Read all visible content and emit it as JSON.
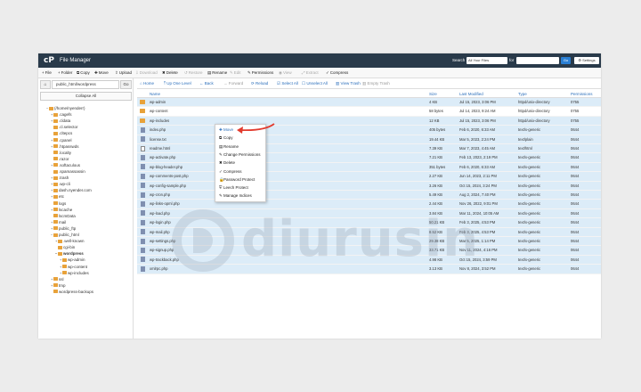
{
  "topbar": {
    "title": "File Manager",
    "search_label": "Search",
    "search_scope": "All Your Files",
    "search_for_label": "for",
    "go_label": "Go",
    "settings_label": "Settings"
  },
  "toolbar": [
    {
      "icon": "+",
      "label": "File",
      "disabled": false
    },
    {
      "icon": "+",
      "label": "Folder",
      "disabled": false
    },
    {
      "icon": "⧉",
      "label": "Copy",
      "disabled": false
    },
    {
      "icon": "✚",
      "label": "Move",
      "disabled": false
    },
    {
      "icon": "⇪",
      "label": "Upload",
      "disabled": false
    },
    {
      "icon": "⇩",
      "label": "Download",
      "disabled": true
    },
    {
      "icon": "✖",
      "label": "Delete",
      "disabled": false
    },
    {
      "icon": "↺",
      "label": "Restore",
      "disabled": true
    },
    {
      "icon": "▤",
      "label": "Rename",
      "disabled": false
    },
    {
      "icon": "✎",
      "label": "Edit",
      "disabled": true
    },
    {
      "icon": "✎",
      "label": "Permissions",
      "disabled": false
    },
    {
      "icon": "◉",
      "label": "View",
      "disabled": true
    },
    {
      "icon": "⤢",
      "label": "Extract",
      "disabled": true
    },
    {
      "icon": "✓",
      "label": "Compress",
      "disabled": false
    }
  ],
  "left": {
    "path_value": "public_html/wordpress",
    "go_label": "Go",
    "collapse_label": "Collapse All",
    "tree": [
      {
        "label": "(/home/nyenderr)",
        "depth": 0,
        "expander": "−",
        "bold": false
      },
      {
        "label": ".cagefs",
        "depth": 1,
        "expander": "+",
        "bold": false
      },
      {
        "label": ".cldata",
        "depth": 1,
        "expander": "+",
        "bold": false
      },
      {
        "label": ".cl.selector",
        "depth": 1,
        "expander": "",
        "bold": false
      },
      {
        "label": ".cltepcs",
        "depth": 1,
        "expander": "",
        "bold": false
      },
      {
        "label": ".cpanel",
        "depth": 1,
        "expander": "+",
        "bold": false
      },
      {
        "label": ".htpasswds",
        "depth": 1,
        "expander": "+",
        "bold": false
      },
      {
        "label": ".localty",
        "depth": 1,
        "expander": "",
        "bold": false
      },
      {
        "label": ".razor",
        "depth": 1,
        "expander": "",
        "bold": false
      },
      {
        "label": ".softaculous",
        "depth": 1,
        "expander": "+",
        "bold": false
      },
      {
        "label": ".spamassassin",
        "depth": 1,
        "expander": "",
        "bold": false
      },
      {
        "label": ".trash",
        "depth": 1,
        "expander": "+",
        "bold": false
      },
      {
        "label": ".wp-cli",
        "depth": 1,
        "expander": "+",
        "bold": false
      },
      {
        "label": "dash.nyender.com",
        "depth": 1,
        "expander": "+",
        "bold": false
      },
      {
        "label": "etc",
        "depth": 1,
        "expander": "+",
        "bold": false
      },
      {
        "label": "logs",
        "depth": 1,
        "expander": "",
        "bold": false
      },
      {
        "label": "lscache",
        "depth": 1,
        "expander": "+",
        "bold": false
      },
      {
        "label": "lscmData",
        "depth": 1,
        "expander": "",
        "bold": false
      },
      {
        "label": "mail",
        "depth": 1,
        "expander": "+",
        "bold": false
      },
      {
        "label": "public_ftp",
        "depth": 1,
        "expander": "+",
        "bold": false
      },
      {
        "label": "public_html",
        "depth": 1,
        "expander": "−",
        "bold": false
      },
      {
        "label": ".well-known",
        "depth": 2,
        "expander": "+",
        "bold": false
      },
      {
        "label": "cgi-bin",
        "depth": 2,
        "expander": "",
        "bold": false
      },
      {
        "label": "wordpress",
        "depth": 2,
        "expander": "−",
        "bold": true
      },
      {
        "label": "wp-admin",
        "depth": 3,
        "expander": "+",
        "bold": false
      },
      {
        "label": "wp-content",
        "depth": 3,
        "expander": "+",
        "bold": false
      },
      {
        "label": "wp-includes",
        "depth": 3,
        "expander": "+",
        "bold": false
      },
      {
        "label": "ssl",
        "depth": 1,
        "expander": "+",
        "bold": false
      },
      {
        "label": "tmp",
        "depth": 1,
        "expander": "+",
        "bold": false
      },
      {
        "label": "wordpress-backups",
        "depth": 1,
        "expander": "",
        "bold": false
      }
    ]
  },
  "actions": [
    {
      "icon": "⌂",
      "label": "Home",
      "disabled": false
    },
    {
      "icon": "⤒",
      "label": "Up One Level",
      "disabled": false
    },
    {
      "icon": "←",
      "label": "Back",
      "disabled": false
    },
    {
      "icon": "→",
      "label": "Forward",
      "disabled": true
    },
    {
      "icon": "⟳",
      "label": "Reload",
      "disabled": false
    },
    {
      "icon": "☑",
      "label": "Select All",
      "disabled": false
    },
    {
      "icon": "☐",
      "label": "Unselect All",
      "disabled": false
    },
    {
      "icon": "▥",
      "label": "View Trash",
      "disabled": false
    },
    {
      "icon": "▥",
      "label": "Empty Trash",
      "disabled": true
    }
  ],
  "columns": {
    "name": "Name",
    "size": "Size",
    "modified": "Last Modified",
    "type": "Type",
    "perms": "Permissions"
  },
  "files": [
    {
      "name": "wp-admin",
      "size": "4 KB",
      "modified": "Jul 15, 2023, 3:06 PM",
      "type": "httpd/unix-directory",
      "perms": "0755",
      "kind": "dir",
      "selected": true
    },
    {
      "name": "wp-content",
      "size": "58 bytes",
      "modified": "Jul 14, 2023, 9:24 AM",
      "type": "httpd/unix-directory",
      "perms": "0755",
      "kind": "dir",
      "selected": false
    },
    {
      "name": "wp-includes",
      "size": "12 KB",
      "modified": "Jul 15, 2023, 3:06 PM",
      "type": "httpd/unix-directory",
      "perms": "0755",
      "kind": "dir",
      "selected": true
    },
    {
      "name": "index.php",
      "size": "405 bytes",
      "modified": "Feb 6, 2020, 6:33 AM",
      "type": "text/x-generic",
      "perms": "0644",
      "kind": "file",
      "selected": true
    },
    {
      "name": "license.txt",
      "size": "19.44 KB",
      "modified": "Mar 5, 2023, 2:24 PM",
      "type": "text/plain",
      "perms": "0644",
      "kind": "file",
      "selected": true
    },
    {
      "name": "readme.html",
      "size": "7.39 KB",
      "modified": "Mar 7, 2023, 4:45 AM",
      "type": "text/html",
      "perms": "0644",
      "kind": "txt",
      "selected": true
    },
    {
      "name": "wp-activate.php",
      "size": "7.21 KB",
      "modified": "Feb 13, 2023, 2:19 PM",
      "type": "text/x-generic",
      "perms": "0644",
      "kind": "file",
      "selected": true
    },
    {
      "name": "wp-blog-header.php",
      "size": "351 bytes",
      "modified": "Feb 6, 2020, 6:33 AM",
      "type": "text/x-generic",
      "perms": "0644",
      "kind": "file",
      "selected": true
    },
    {
      "name": "wp-comments-post.php",
      "size": "2.27 KB",
      "modified": "Jun 14, 2023, 2:11 PM",
      "type": "text/x-generic",
      "perms": "0644",
      "kind": "file",
      "selected": true
    },
    {
      "name": "wp-config-sample.php",
      "size": "3.26 KB",
      "modified": "Oct 15, 2024, 3:24 PM",
      "type": "text/x-generic",
      "perms": "0644",
      "kind": "file",
      "selected": true
    },
    {
      "name": "wp-cron.php",
      "size": "5.49 KB",
      "modified": "Aug 2, 2024, 7:40 PM",
      "type": "text/x-generic",
      "perms": "0644",
      "kind": "file",
      "selected": true
    },
    {
      "name": "wp-links-opml.php",
      "size": "2.44 KB",
      "modified": "Nov 26, 2022, 9:01 PM",
      "type": "text/x-generic",
      "perms": "0644",
      "kind": "file",
      "selected": true
    },
    {
      "name": "wp-load.php",
      "size": "3.84 KB",
      "modified": "Mar 11, 2024, 10:05 AM",
      "type": "text/x-generic",
      "perms": "0644",
      "kind": "file",
      "selected": true
    },
    {
      "name": "wp-login.php",
      "size": "50.21 KB",
      "modified": "Feb 3, 2025, 4:53 PM",
      "type": "text/x-generic",
      "perms": "0644",
      "kind": "file",
      "selected": true
    },
    {
      "name": "wp-mail.php",
      "size": "8.52 KB",
      "modified": "Feb 3, 2025, 4:53 PM",
      "type": "text/x-generic",
      "perms": "0644",
      "kind": "file",
      "selected": true
    },
    {
      "name": "wp-settings.php",
      "size": "29.38 KB",
      "modified": "Mar 5, 2025, 1:14 PM",
      "type": "text/x-generic",
      "perms": "0644",
      "kind": "file",
      "selected": true
    },
    {
      "name": "wp-signup.php",
      "size": "33.71 KB",
      "modified": "Nov 11, 2024, 4:16 PM",
      "type": "text/x-generic",
      "perms": "0644",
      "kind": "file",
      "selected": true
    },
    {
      "name": "wp-trackback.php",
      "size": "4.98 KB",
      "modified": "Oct 15, 2024, 3:59 PM",
      "type": "text/x-generic",
      "perms": "0644",
      "kind": "file",
      "selected": true
    },
    {
      "name": "xmlrpc.php",
      "size": "3.13 KB",
      "modified": "Nov 8, 2024, 3:52 PM",
      "type": "text/x-generic",
      "perms": "0644",
      "kind": "file",
      "selected": true
    }
  ],
  "context_menu": [
    {
      "icon": "✚",
      "label": "Move"
    },
    {
      "icon": "⧉",
      "label": "Copy"
    },
    {
      "icon": "▤",
      "label": "Rename"
    },
    {
      "icon": "✎",
      "label": "Change Permissions"
    },
    {
      "icon": "✖",
      "label": "Delete"
    },
    {
      "icon": "✓",
      "label": "Compress"
    },
    {
      "icon": "🔒",
      "label": "Password Protect"
    },
    {
      "icon": "⛨",
      "label": "Leech Protect"
    },
    {
      "icon": "✎",
      "label": "Manage Indices"
    }
  ],
  "watermark": {
    "text": "diurusin"
  },
  "colors": {
    "topbar": "#293a4a",
    "accent": "#2a7fd4",
    "link": "#2a6ebb",
    "selected_row": "#dcecf8",
    "folder": "#e8a23a",
    "arrow": "#e23b2e"
  }
}
